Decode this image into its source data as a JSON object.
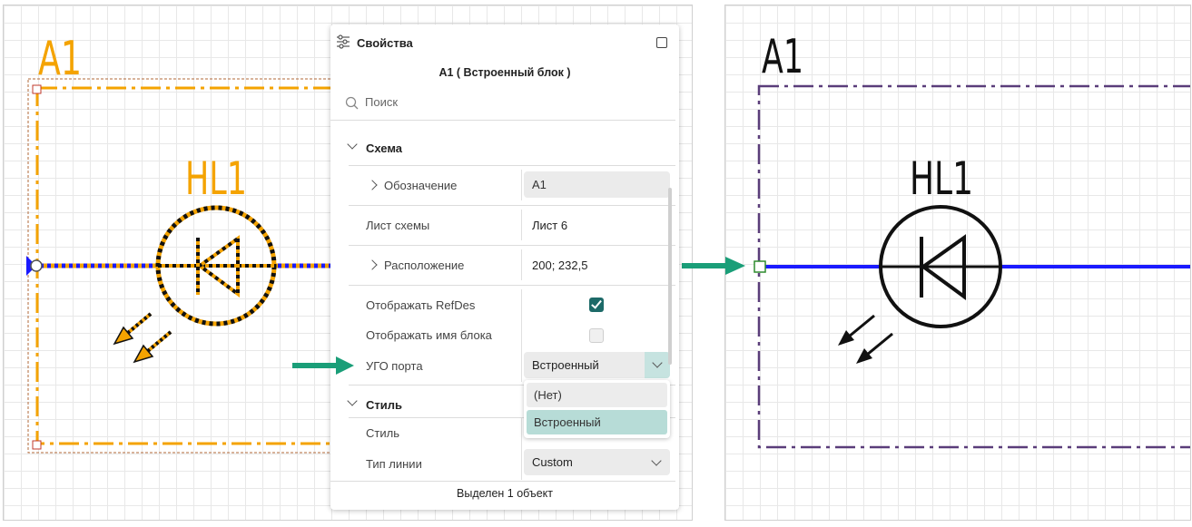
{
  "colors": {
    "selected_orange": "#f4a300",
    "wire_blue": "#1a1aff",
    "block_border_purple": "#5a3d7a",
    "accent_teal": "#1d6a68",
    "arrow_green": "#1a9e78"
  },
  "left_canvas": {
    "block_refdes": "A1",
    "component_refdes": "HL1"
  },
  "right_canvas": {
    "block_refdes": "A1",
    "component_refdes": "HL1"
  },
  "panel": {
    "title": "Свойства",
    "title_icon": "sliders-icon",
    "maximize_icon": "maximize-icon",
    "subtitle": "A1 ( Встроенный блок )",
    "search_placeholder": "Поиск",
    "sections": {
      "schema": {
        "label": "Схема",
        "designation": {
          "label": "Обозначение",
          "value": "A1"
        },
        "sheet": {
          "label": "Лист схемы",
          "value": "Лист 6"
        },
        "location": {
          "label": "Расположение",
          "value": "200; 232,5"
        },
        "show_refdes": {
          "label": "Отображать RefDes",
          "checked": true
        },
        "show_block_name": {
          "label": "Отображать имя блока",
          "checked": false
        },
        "port_symbol": {
          "label": "УГО порта",
          "value": "Встроенный",
          "options": [
            "(Нет)",
            "Встроенный"
          ],
          "selected": "Встроенный"
        }
      },
      "style": {
        "label": "Стиль",
        "style_row": {
          "label": "Стиль",
          "value": ""
        },
        "line_type": {
          "label": "Тип линии",
          "value": "Custom"
        }
      }
    },
    "status": "Выделен 1 объект"
  }
}
